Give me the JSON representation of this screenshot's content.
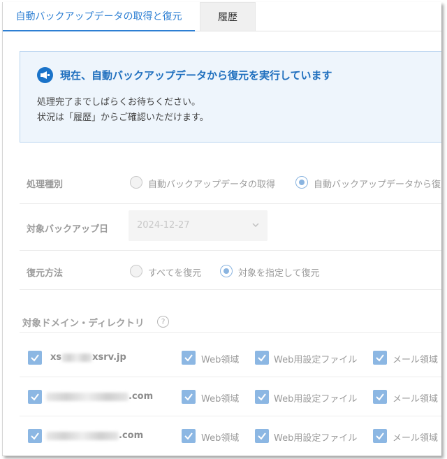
{
  "tabs": [
    {
      "label": "自動バックアップデータの取得と復元"
    },
    {
      "label": "履歴"
    }
  ],
  "notice": {
    "icon": "megaphone-icon",
    "title": "現在、自動バックアップデータから復元を実行しています",
    "line1": "処理完了までしばらくお待ちください。",
    "line2": "状況は「履歴」からご確認いただけます。"
  },
  "form": {
    "process_type": {
      "label": "処理種別",
      "options": [
        "自動バックアップデータの取得",
        "自動バックアップデータから復"
      ],
      "selected_index": 1
    },
    "backup_date": {
      "label": "対象バックアップ日",
      "value": "2024-12-27"
    },
    "restore_method": {
      "label": "復元方法",
      "options": [
        "すべてを復元",
        "対象を指定して復元"
      ],
      "selected_index": 1
    }
  },
  "domains": {
    "title": "対象ドメイン・ディレクトリ",
    "help": "?",
    "rows": [
      {
        "prefix": "xs",
        "suffix": "xsrv.jp",
        "web": "Web領域",
        "web_config": "Web用設定ファイル",
        "mail": "メール領域"
      },
      {
        "prefix": "",
        "suffix": ".com",
        "web": "Web領域",
        "web_config": "Web用設定ファイル",
        "mail": "メール領域"
      },
      {
        "prefix": "",
        "suffix": ".com",
        "web": "Web領域",
        "web_config": "Web用設定ファイル",
        "mail": "メール領域"
      }
    ]
  },
  "colors": {
    "accent": "#2d7fd3",
    "checkbox": "#8cb7e3",
    "notice_bg": "#eef5fc"
  }
}
